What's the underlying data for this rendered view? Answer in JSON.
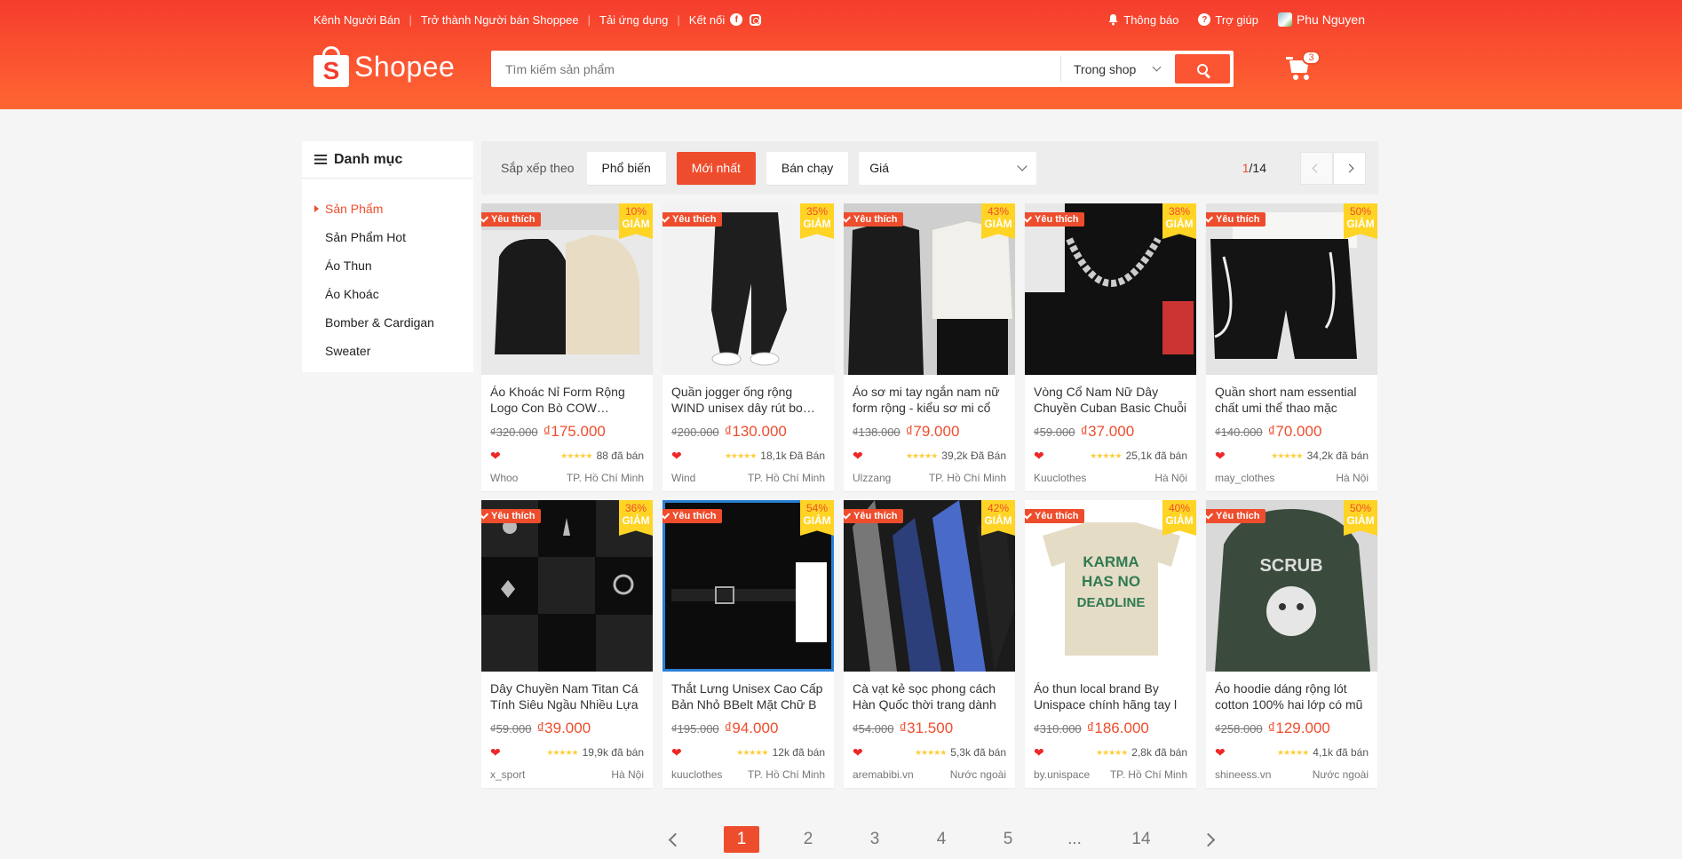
{
  "topbar": {
    "links": [
      "Kênh Người Bán",
      "Trở thành Người bán Shoppee",
      "Tải ứng dụng"
    ],
    "connect_label": "Kết nối",
    "notifications": "Thông báo",
    "help": "Trợ giúp",
    "user": "Phu Nguyen"
  },
  "logo": {
    "text": "Shopee",
    "mark": "S"
  },
  "search": {
    "placeholder": "Tìm kiếm sản phẩm",
    "value": "",
    "scope": "Trong shop"
  },
  "cart": {
    "count": "3"
  },
  "sidebar": {
    "title": "Danh mục",
    "items": [
      "Sản Phẩm",
      "Sản Phẩm Hot",
      "Áo Thun",
      "Áo Khoác",
      "Bomber & Cardigan",
      "Sweater"
    ]
  },
  "sort": {
    "label": "Sắp xếp theo",
    "options": [
      "Phổ biến",
      "Mới nhất",
      "Bán chạy"
    ],
    "price": "Giá",
    "page_current": "1",
    "page_total": "/14"
  },
  "badge": {
    "fav": "Yêu thích",
    "giam": "GIẢM"
  },
  "products": [
    {
      "name": "Áo Khoác Nỉ Form Rộng Logo Con Bò COW Ulzzang",
      "old": "₫320.000",
      "new": "₫175.000",
      "sold": "88 đã bán",
      "shop": "Whoo",
      "loc": "TP. Hồ Chí Minh",
      "disc": "10%"
    },
    {
      "name": "Quần jogger ống rộng WIND unisex dây rút bo chun",
      "old": "₫200.000",
      "new": "₫130.000",
      "sold": "18,1k Đã Bán",
      "shop": "Wind",
      "loc": "TP. Hồ Chí Minh",
      "disc": "35%"
    },
    {
      "name": "Áo sơ mi tay ngắn nam nữ form rộng - kiểu sơ mi cổ",
      "old": "₫138.000",
      "new": "₫79.000",
      "sold": "39,2k Đã Bán",
      "shop": "Ulzzang",
      "loc": "TP. Hồ Chí Minh",
      "disc": "43%"
    },
    {
      "name": "Vòng Cổ Nam Nữ Dây Chuyền Cuban Basic Chuỗi",
      "old": "₫59.000",
      "new": "₫37.000",
      "sold": "25,1k đã bán",
      "shop": "Kuuclothes",
      "loc": "Hà Nội",
      "disc": "38%"
    },
    {
      "name": "Quần short nam essential chất umi thể thao mặc",
      "old": "₫140.000",
      "new": "₫70.000",
      "sold": "34,2k đã bán",
      "shop": "may_clothes",
      "loc": "Hà Nội",
      "disc": "50%"
    },
    {
      "name": "Dây Chuyền Nam Titan Cá Tính Siêu Ngầu Nhiều Lựa",
      "old": "₫59.000",
      "new": "₫39.000",
      "sold": "19,9k đã bán",
      "shop": "x_sport",
      "loc": "Hà Nội",
      "disc": "36%"
    },
    {
      "name": "Thắt Lưng Unisex Cao Cấp Bản Nhỏ BBelt Mặt Chữ B",
      "old": "₫195.000",
      "new": "₫94.000",
      "sold": "12k đã bán",
      "shop": "kuuclothes",
      "loc": "TP. Hồ Chí Minh",
      "disc": "54%"
    },
    {
      "name": "Cà vạt kẻ sọc phong cách Hàn Quốc thời trang dành",
      "old": "₫54.000",
      "new": "₫31.500",
      "sold": "5,3k đã bán",
      "shop": "aremabibi.vn",
      "loc": "Nước ngoài",
      "disc": "42%"
    },
    {
      "name": "Áo thun local brand By Unispace chính hãng tay l",
      "old": "₫310.000",
      "new": "₫186.000",
      "sold": "2,8k đã bán",
      "shop": "by.unispace",
      "loc": "TP. Hồ Chí Minh",
      "disc": "40%"
    },
    {
      "name": "Áo hoodie dáng rộng lót cotton 100% hai lớp có mũ",
      "old": "₫258.000",
      "new": "₫129.000",
      "sold": "4,1k đã bán",
      "shop": "shineess.vn",
      "loc": "Nước ngoài",
      "disc": "50%"
    }
  ],
  "pagination": {
    "pages": [
      "1",
      "2",
      "3",
      "4",
      "5",
      "...",
      "14"
    ],
    "current": "1"
  },
  "colors": {
    "brand": "#ee4d2d",
    "header_top": "#f53d2d",
    "header_bottom": "#ff6633",
    "star": "#ffce3d",
    "discount_bg": "#ffd424"
  },
  "icons": [
    "bell-icon",
    "help-icon",
    "facebook-icon",
    "instagram-icon",
    "cart-icon",
    "search-icon",
    "list-icon",
    "heart-icon",
    "star-icon"
  ]
}
